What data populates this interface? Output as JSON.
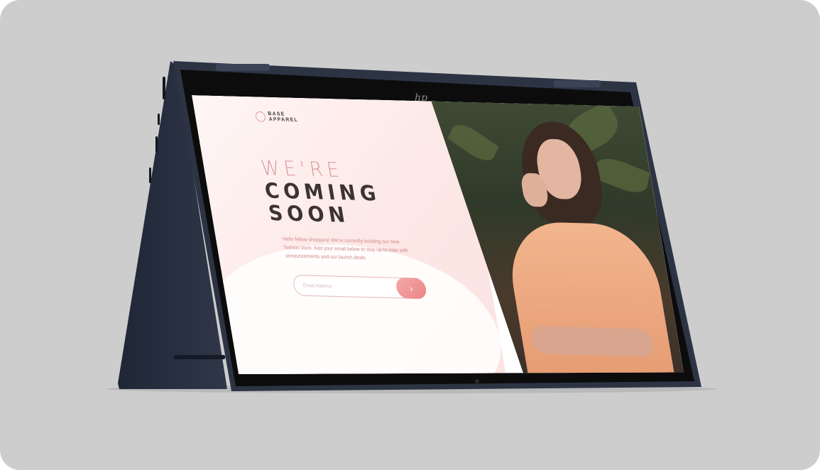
{
  "device": {
    "brand_mark": "hp"
  },
  "site": {
    "logo_line1": "BASE",
    "logo_line2": "APPAREL",
    "heading_light": "WE'RE",
    "heading_dark_line1": "COMING",
    "heading_dark_line2": "SOON",
    "description": "Hello fellow shoppers! We're currently building our new fashion store. Add your email below to stay up-to-date with announcements and our launch deals.",
    "email_placeholder": "Email Address",
    "submit_icon": "chevron-right-icon",
    "submit_glyph": "›"
  },
  "colors": {
    "background": "#cdcdcd",
    "laptop_body": "#2b3242",
    "accent": "#eb8585",
    "heading_dark": "#3b3333"
  }
}
